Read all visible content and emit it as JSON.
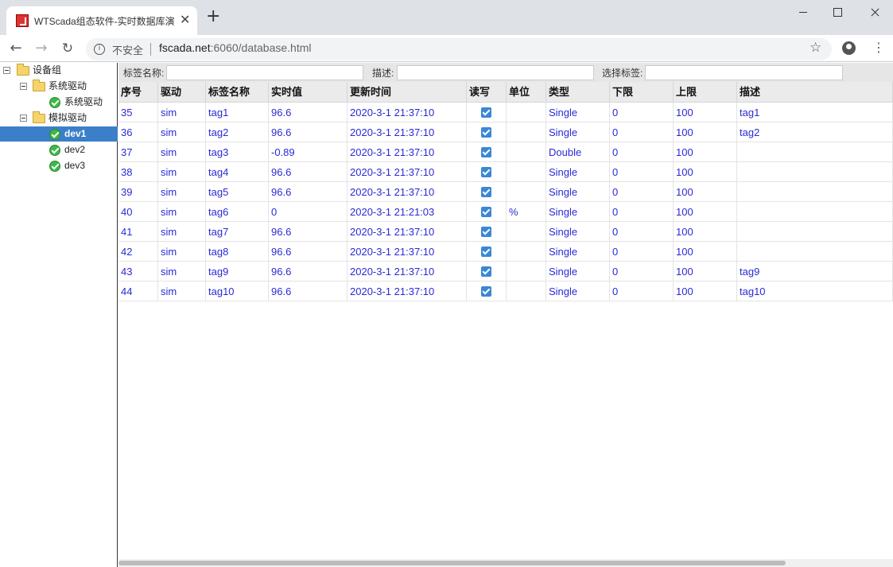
{
  "browser": {
    "tab_title": "WTScada组态软件-实时数据库演",
    "tab_close": "✕",
    "new_tab": "+",
    "insecure_label": "不安全",
    "url_host": "fscada.net",
    "url_rest": ":6060/database.html"
  },
  "tree": {
    "root": "设备组",
    "groups": [
      {
        "label": "系统驱动",
        "devices": [
          "系统驱动"
        ]
      },
      {
        "label": "模拟驱动",
        "devices": [
          "dev1",
          "dev2",
          "dev3"
        ]
      }
    ],
    "selected": "dev1"
  },
  "filters": {
    "tag_name_label": "标签名称:",
    "desc_label": "描述:",
    "select_tag_label": "选择标签:"
  },
  "grid": {
    "columns": [
      "序号",
      "驱动",
      "标签名称",
      "实时值",
      "更新时间",
      "读写",
      "单位",
      "类型",
      "下限",
      "上限",
      "描述"
    ],
    "rows": [
      [
        "35",
        "sim",
        "tag1",
        "96.6",
        "2020-3-1 21:37:10",
        true,
        "",
        "Single",
        "0",
        "100",
        "tag1"
      ],
      [
        "36",
        "sim",
        "tag2",
        "96.6",
        "2020-3-1 21:37:10",
        true,
        "",
        "Single",
        "0",
        "100",
        "tag2"
      ],
      [
        "37",
        "sim",
        "tag3",
        "-0.89",
        "2020-3-1 21:37:10",
        true,
        "",
        "Double",
        "0",
        "100",
        ""
      ],
      [
        "38",
        "sim",
        "tag4",
        "96.6",
        "2020-3-1 21:37:10",
        true,
        "",
        "Single",
        "0",
        "100",
        ""
      ],
      [
        "39",
        "sim",
        "tag5",
        "96.6",
        "2020-3-1 21:37:10",
        true,
        "",
        "Single",
        "0",
        "100",
        ""
      ],
      [
        "40",
        "sim",
        "tag6",
        "0",
        "2020-3-1 21:21:03",
        true,
        "%",
        "Single",
        "0",
        "100",
        ""
      ],
      [
        "41",
        "sim",
        "tag7",
        "96.6",
        "2020-3-1 21:37:10",
        true,
        "",
        "Single",
        "0",
        "100",
        ""
      ],
      [
        "42",
        "sim",
        "tag8",
        "96.6",
        "2020-3-1 21:37:10",
        true,
        "",
        "Single",
        "0",
        "100",
        ""
      ],
      [
        "43",
        "sim",
        "tag9",
        "96.6",
        "2020-3-1 21:37:10",
        true,
        "",
        "Single",
        "0",
        "100",
        "tag9"
      ],
      [
        "44",
        "sim",
        "tag10",
        "96.6",
        "2020-3-1 21:37:10",
        true,
        "",
        "Single",
        "0",
        "100",
        "tag10"
      ]
    ]
  }
}
